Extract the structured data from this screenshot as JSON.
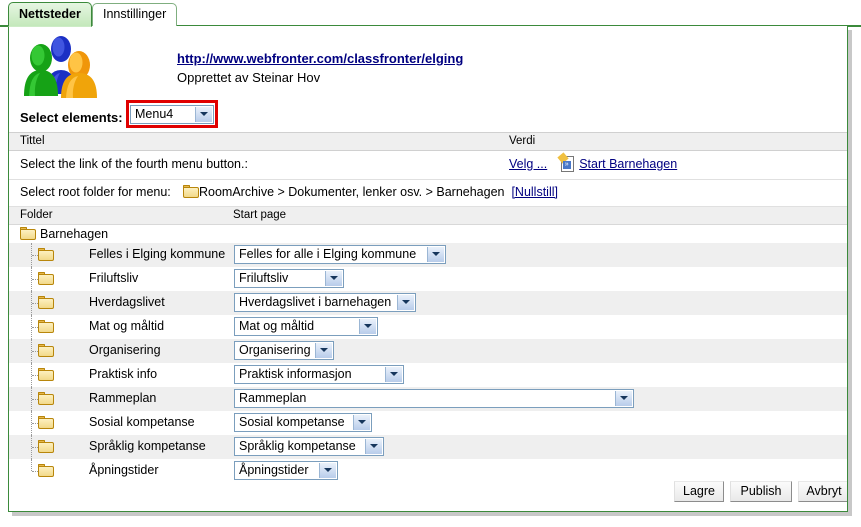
{
  "tabs": [
    {
      "label": "Nettsteder",
      "active": true
    },
    {
      "label": "Innstillinger",
      "active": false
    }
  ],
  "header": {
    "icon": "people-group-icon",
    "site_url": "http://www.webfronter.com/classfronter/elging",
    "created_by": "Opprettet av Steinar Hov"
  },
  "select_elements": {
    "label": "Select elements:",
    "value": "Menu4",
    "highlighted": true,
    "highlight_color": "#e00000"
  },
  "properties_table": {
    "columns": [
      "Tittel",
      "Verdi"
    ],
    "rows": [
      {
        "title": "Select the link of the fourth menu button.:",
        "value_link": "Velg ...",
        "value_icon": "document-link-icon",
        "value_target": "Start Barnehagen"
      }
    ],
    "root_folder_row": {
      "label": "Select root folder for menu:",
      "folder_icon": "folder-icon",
      "path": "RoomArchive > Dokumenter, lenker osv. > Barnehagen",
      "reset_link": "[Nullstill]"
    }
  },
  "folder_table": {
    "columns": [
      "Folder",
      "Start page"
    ],
    "root": {
      "icon": "folder-icon",
      "name": "Barnehagen"
    },
    "rows": [
      {
        "folder": "Felles i Elging kommune",
        "start_page": "Felles for alle i Elging kommune",
        "select_width": 212
      },
      {
        "folder": "Friluftsliv",
        "start_page": "Friluftsliv",
        "select_width": 110
      },
      {
        "folder": "Hverdagslivet",
        "start_page": "Hverdagslivet i barnehagen",
        "select_width": 182
      },
      {
        "folder": "Mat og måltid",
        "start_page": "Mat og måltid",
        "select_width": 144
      },
      {
        "folder": "Organisering",
        "start_page": "Organisering",
        "select_width": 100
      },
      {
        "folder": "Praktisk info",
        "start_page": "Praktisk informasjon",
        "select_width": 170
      },
      {
        "folder": "Rammeplan",
        "start_page": "Rammeplan",
        "select_width": 400
      },
      {
        "folder": "Sosial kompetanse",
        "start_page": "Sosial kompetanse",
        "select_width": 138
      },
      {
        "folder": "Språklig kompetanse",
        "start_page": "Språklig kompetanse",
        "select_width": 150
      },
      {
        "folder": "Åpningstider",
        "start_page": "Åpningstider",
        "select_width": 104
      }
    ]
  },
  "buttons": {
    "save": "Lagre",
    "publish": "Publish",
    "cancel": "Avbryt"
  },
  "colors": {
    "tab_border": "#3b8a3b",
    "tab_active_bg": "#cdecc6",
    "link": "#000080",
    "row_alt": "#efefef",
    "select_border": "#7b9ebd"
  }
}
